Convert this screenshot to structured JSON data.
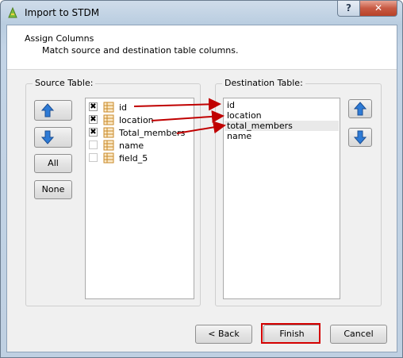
{
  "window": {
    "title": "Import to STDM",
    "help_glyph": "?",
    "close_glyph": "✕",
    "icon": "qgis-app-icon"
  },
  "header": {
    "title": "Assign Columns",
    "subtitle": "Match source and destination table columns."
  },
  "source": {
    "label": "Source Table:",
    "buttons": {
      "up_icon": "arrow-up-icon",
      "down_icon": "arrow-down-icon",
      "all": "All",
      "none": "None"
    },
    "columns": [
      {
        "name": "id",
        "checked": true,
        "check_glyph": "✖"
      },
      {
        "name": "location",
        "checked": true,
        "check_glyph": "✖"
      },
      {
        "name": "Total_members",
        "checked": true,
        "check_glyph": "✖"
      },
      {
        "name": "name",
        "checked": false,
        "check_glyph": ""
      },
      {
        "name": "field_5",
        "checked": false,
        "check_glyph": ""
      }
    ]
  },
  "destination": {
    "label": "Destination Table:",
    "buttons": {
      "up_icon": "arrow-up-icon",
      "down_icon": "arrow-down-icon"
    },
    "columns": [
      {
        "name": "id"
      },
      {
        "name": "location"
      },
      {
        "name": "total_members",
        "highlighted": true
      },
      {
        "name": "name"
      }
    ]
  },
  "footer": {
    "back": "< Back",
    "finish": "Finish",
    "cancel": "Cancel"
  },
  "annotation_color": "#c00000"
}
